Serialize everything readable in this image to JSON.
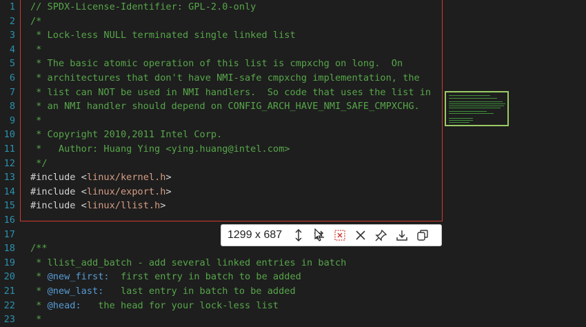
{
  "editor": {
    "lines": [
      {
        "num": "1",
        "tokens": [
          {
            "text": "// SPDX-License-Identifier: GPL-2.0-only",
            "cls": "t-comment"
          }
        ]
      },
      {
        "num": "2",
        "tokens": [
          {
            "text": "/*",
            "cls": "t-comment"
          }
        ]
      },
      {
        "num": "3",
        "tokens": [
          {
            "text": " * Lock-less NULL terminated single linked list",
            "cls": "t-comment"
          }
        ]
      },
      {
        "num": "4",
        "tokens": [
          {
            "text": " *",
            "cls": "t-comment"
          }
        ]
      },
      {
        "num": "5",
        "tokens": [
          {
            "text": " * The basic atomic operation of this list is cmpxchg on long.  On",
            "cls": "t-comment"
          }
        ]
      },
      {
        "num": "6",
        "tokens": [
          {
            "text": " * architectures that don't have NMI-safe cmpxchg implementation, the",
            "cls": "t-comment"
          }
        ]
      },
      {
        "num": "7",
        "tokens": [
          {
            "text": " * list can NOT be used in NMI handlers.  So code that uses the list in",
            "cls": "t-comment"
          }
        ]
      },
      {
        "num": "8",
        "tokens": [
          {
            "text": " * an NMI handler should depend on CONFIG_ARCH_HAVE_NMI_SAFE_CMPXCHG.",
            "cls": "t-comment"
          }
        ]
      },
      {
        "num": "9",
        "tokens": [
          {
            "text": " *",
            "cls": "t-comment"
          }
        ]
      },
      {
        "num": "10",
        "tokens": [
          {
            "text": " * Copyright 2010,2011 Intel Corp.",
            "cls": "t-comment"
          }
        ]
      },
      {
        "num": "11",
        "tokens": [
          {
            "text": " *   Author: Huang Ying <ying.huang@intel.com>",
            "cls": "t-comment"
          }
        ]
      },
      {
        "num": "12",
        "tokens": [
          {
            "text": " */",
            "cls": "t-comment"
          }
        ]
      },
      {
        "num": "13",
        "tokens": [
          {
            "text": "#include ",
            "cls": "t-plain"
          },
          {
            "text": "<",
            "cls": "t-plain"
          },
          {
            "text": "linux/kernel.h",
            "cls": "t-path"
          },
          {
            "text": ">",
            "cls": "t-plain"
          }
        ]
      },
      {
        "num": "14",
        "tokens": [
          {
            "text": "#include ",
            "cls": "t-plain"
          },
          {
            "text": "<",
            "cls": "t-plain"
          },
          {
            "text": "linux/export.h",
            "cls": "t-path"
          },
          {
            "text": ">",
            "cls": "t-plain"
          }
        ]
      },
      {
        "num": "15",
        "tokens": [
          {
            "text": "#include ",
            "cls": "t-plain"
          },
          {
            "text": "<",
            "cls": "t-plain"
          },
          {
            "text": "linux/llist.h",
            "cls": "t-path"
          },
          {
            "text": ">",
            "cls": "t-plain"
          }
        ]
      },
      {
        "num": "16",
        "tokens": []
      },
      {
        "num": "17",
        "tokens": []
      },
      {
        "num": "18",
        "tokens": [
          {
            "text": "/**",
            "cls": "t-comment"
          }
        ]
      },
      {
        "num": "19",
        "tokens": [
          {
            "text": " * llist_add_batch - add several linked entries in batch",
            "cls": "t-comment"
          }
        ]
      },
      {
        "num": "20",
        "tokens": [
          {
            "text": " * ",
            "cls": "t-comment"
          },
          {
            "text": "@new_first:",
            "cls": "t-tag"
          },
          {
            "text": "  first entry in batch to be added",
            "cls": "t-comment"
          }
        ]
      },
      {
        "num": "21",
        "tokens": [
          {
            "text": " * ",
            "cls": "t-comment"
          },
          {
            "text": "@new_last:",
            "cls": "t-tag"
          },
          {
            "text": "   last entry in batch to be added",
            "cls": "t-comment"
          }
        ]
      },
      {
        "num": "22",
        "tokens": [
          {
            "text": " * ",
            "cls": "t-comment"
          },
          {
            "text": "@head:",
            "cls": "t-tag"
          },
          {
            "text": "   the head for your lock-less list",
            "cls": "t-comment"
          }
        ]
      },
      {
        "num": "23",
        "tokens": [
          {
            "text": " *",
            "cls": "t-comment"
          }
        ]
      }
    ]
  },
  "capture_toolbar": {
    "dimensions": "1299 x 687",
    "buttons": [
      {
        "name": "resize-height-icon",
        "label": "resize"
      },
      {
        "name": "swap-icon",
        "label": "swap"
      },
      {
        "name": "pixelate-icon",
        "label": "pixelate"
      },
      {
        "name": "close-icon",
        "label": "close"
      },
      {
        "name": "pin-icon",
        "label": "pin"
      },
      {
        "name": "download-icon",
        "label": "download"
      },
      {
        "name": "copy-icon",
        "label": "copy"
      }
    ]
  },
  "colors": {
    "selection_border": "#d13a31",
    "thumbnail_border": "#9ccc65",
    "comment": "#57a64a",
    "path": "#d69d85",
    "tag": "#569cd6",
    "line_number": "#2b91af"
  }
}
